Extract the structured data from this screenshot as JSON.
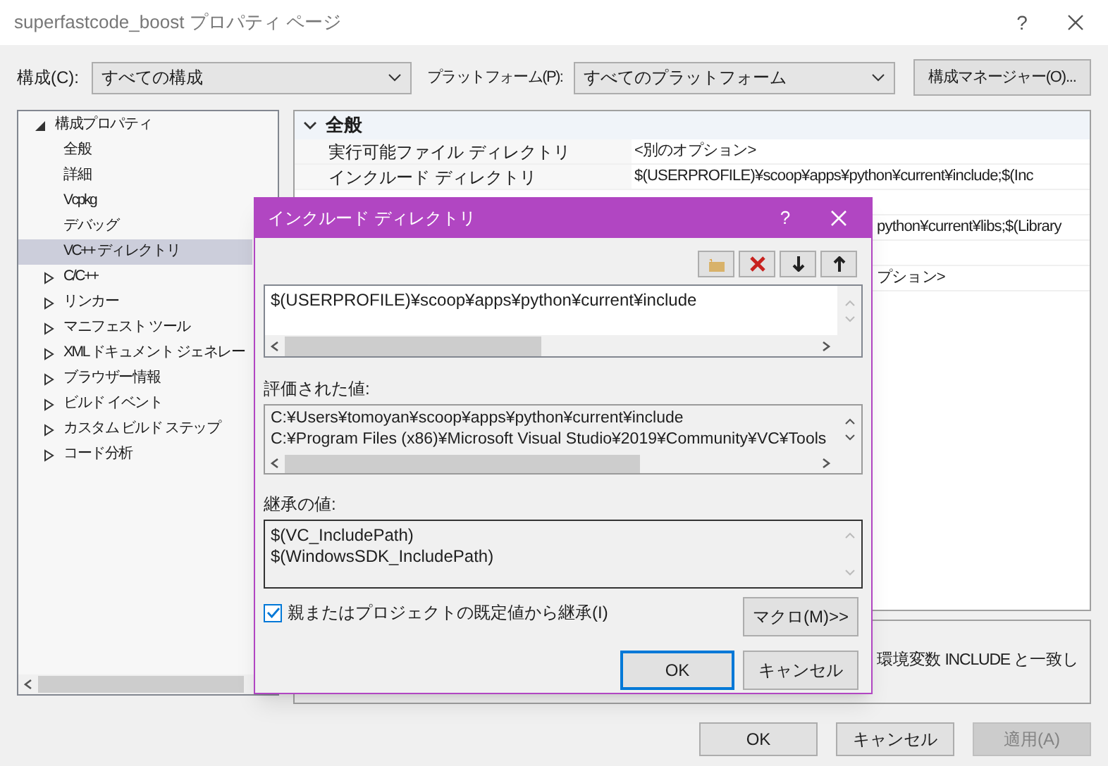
{
  "window": {
    "title": "superfastcode_boost プロパティ ページ",
    "help": "?"
  },
  "toolbar": {
    "configuration_label": "構成(C):",
    "configuration_value": "すべての構成",
    "platform_label": "プラットフォーム(P):",
    "platform_value": "すべてのプラットフォーム",
    "manager_button": "構成マネージャー(O)..."
  },
  "tree": {
    "items": [
      {
        "label": "構成プロパティ",
        "kind": "group",
        "expanded": true,
        "selected": false,
        "children": [
          {
            "label": "全般",
            "kind": "leaf",
            "selected": false
          },
          {
            "label": "詳細",
            "kind": "leaf",
            "selected": false
          },
          {
            "label": "Vcpkg",
            "kind": "leaf",
            "selected": false
          },
          {
            "label": "デバッグ",
            "kind": "leaf",
            "selected": false
          },
          {
            "label": "VC++ ディレクトリ",
            "kind": "leaf",
            "selected": true
          },
          {
            "label": "C/C++",
            "kind": "group",
            "expanded": false,
            "selected": false
          },
          {
            "label": "リンカー",
            "kind": "group",
            "expanded": false,
            "selected": false
          },
          {
            "label": "マニフェスト ツール",
            "kind": "group",
            "expanded": false,
            "selected": false
          },
          {
            "label": "XML ドキュメント ジェネレー",
            "kind": "group",
            "expanded": false,
            "selected": false
          },
          {
            "label": "ブラウザー情報",
            "kind": "group",
            "expanded": false,
            "selected": false
          },
          {
            "label": "ビルド イベント",
            "kind": "group",
            "expanded": false,
            "selected": false
          },
          {
            "label": "カスタム ビルド ステップ",
            "kind": "group",
            "expanded": false,
            "selected": false
          },
          {
            "label": "コード分析",
            "kind": "group",
            "expanded": false,
            "selected": false
          }
        ]
      }
    ]
  },
  "grid": {
    "section": {
      "label": "全般",
      "expanded": true
    },
    "rows": [
      {
        "kind": "full",
        "name": "実行可能ファイル ディレクトリ",
        "value": "<別のオプション>"
      },
      {
        "kind": "full",
        "name": "インクルード ディレクトリ",
        "value": "$(USERPROFILE)¥scoop¥apps¥python¥current¥include;$(Inc"
      },
      {
        "kind": "covered"
      },
      {
        "kind": "covered",
        "value": "python¥current¥libs;$(Library"
      },
      {
        "kind": "covered"
      },
      {
        "kind": "covered",
        "value": "プション>"
      }
    ]
  },
  "description": "環境変数 INCLUDE と一致し",
  "buttons": [
    {
      "label": "OK",
      "disabled": false
    },
    {
      "label": "キャンセル",
      "disabled": false
    },
    {
      "label": "適用(A)",
      "disabled": true
    }
  ],
  "dialog": {
    "title": "インクルード ディレクトリ",
    "help": "?",
    "entries": [
      "$(USERPROFILE)¥scoop¥apps¥python¥current¥include"
    ],
    "evaluated_label": "評価された値:",
    "evaluated": [
      "C:¥Users¥tomoyan¥scoop¥apps¥python¥current¥include",
      "C:¥Program Files (x86)¥Microsoft Visual Studio¥2019¥Community¥VC¥Tools"
    ],
    "inherited_label": "継承の値:",
    "inherited": [
      "$(VC_IncludePath)",
      "$(WindowsSDK_IncludePath)"
    ],
    "inherit_checkbox": {
      "label": "親またはプロジェクトの既定値から継承(I)",
      "checked": true
    },
    "macro_button": "マクロ(M)>>",
    "buttons": [
      {
        "label": "OK",
        "default": true
      },
      {
        "label": "キャンセル",
        "default": false
      }
    ]
  }
}
